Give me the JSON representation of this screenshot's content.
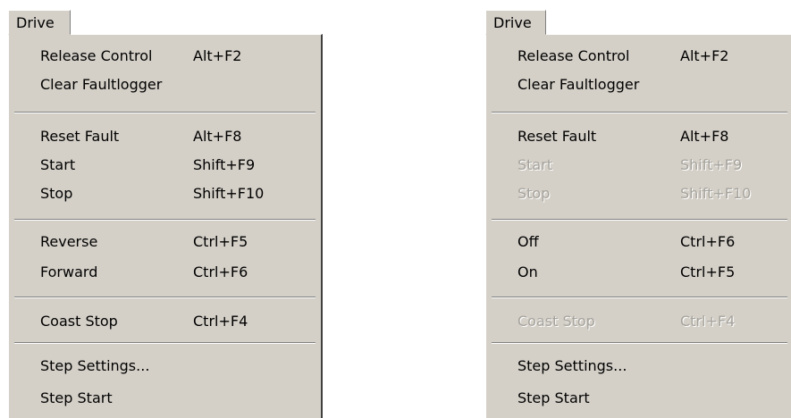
{
  "left_menu": {
    "title": "Drive",
    "items": [
      {
        "label": "Release Control",
        "shortcut": "Alt+F2"
      },
      {
        "label": "Clear Faultlogger",
        "shortcut": ""
      },
      {
        "label": "Reset Fault",
        "shortcut": "Alt+F8"
      },
      {
        "label": "Start",
        "shortcut": "Shift+F9"
      },
      {
        "label": "Stop",
        "shortcut": "Shift+F10"
      },
      {
        "label": "Reverse",
        "shortcut": "Ctrl+F5"
      },
      {
        "label": "Forward",
        "shortcut": "Ctrl+F6"
      },
      {
        "label": "Coast Stop",
        "shortcut": "Ctrl+F4"
      },
      {
        "label": "Step Settings...",
        "shortcut": ""
      },
      {
        "label": "Step Start",
        "shortcut": ""
      }
    ]
  },
  "right_menu": {
    "title": "Drive",
    "items": [
      {
        "label": "Release Control",
        "shortcut": "Alt+F2",
        "enabled": true
      },
      {
        "label": "Clear Faultlogger",
        "shortcut": "",
        "enabled": true
      },
      {
        "label": "Reset Fault",
        "shortcut": "Alt+F8",
        "enabled": true
      },
      {
        "label": "Start",
        "shortcut": "Shift+F9",
        "enabled": false
      },
      {
        "label": "Stop",
        "shortcut": "Shift+F10",
        "enabled": false
      },
      {
        "label": "Off",
        "shortcut": "Ctrl+F6",
        "enabled": true
      },
      {
        "label": "On",
        "shortcut": "Ctrl+F5",
        "enabled": true
      },
      {
        "label": "Coast Stop",
        "shortcut": "Ctrl+F4",
        "enabled": false
      },
      {
        "label": "Step Settings...",
        "shortcut": "",
        "enabled": true
      },
      {
        "label": "Step Start",
        "shortcut": "",
        "enabled": true
      }
    ]
  },
  "colors": {
    "menu_background": "#d4d0c8",
    "disabled_text": "#a6a39c",
    "separator_shadow": "#808080"
  }
}
